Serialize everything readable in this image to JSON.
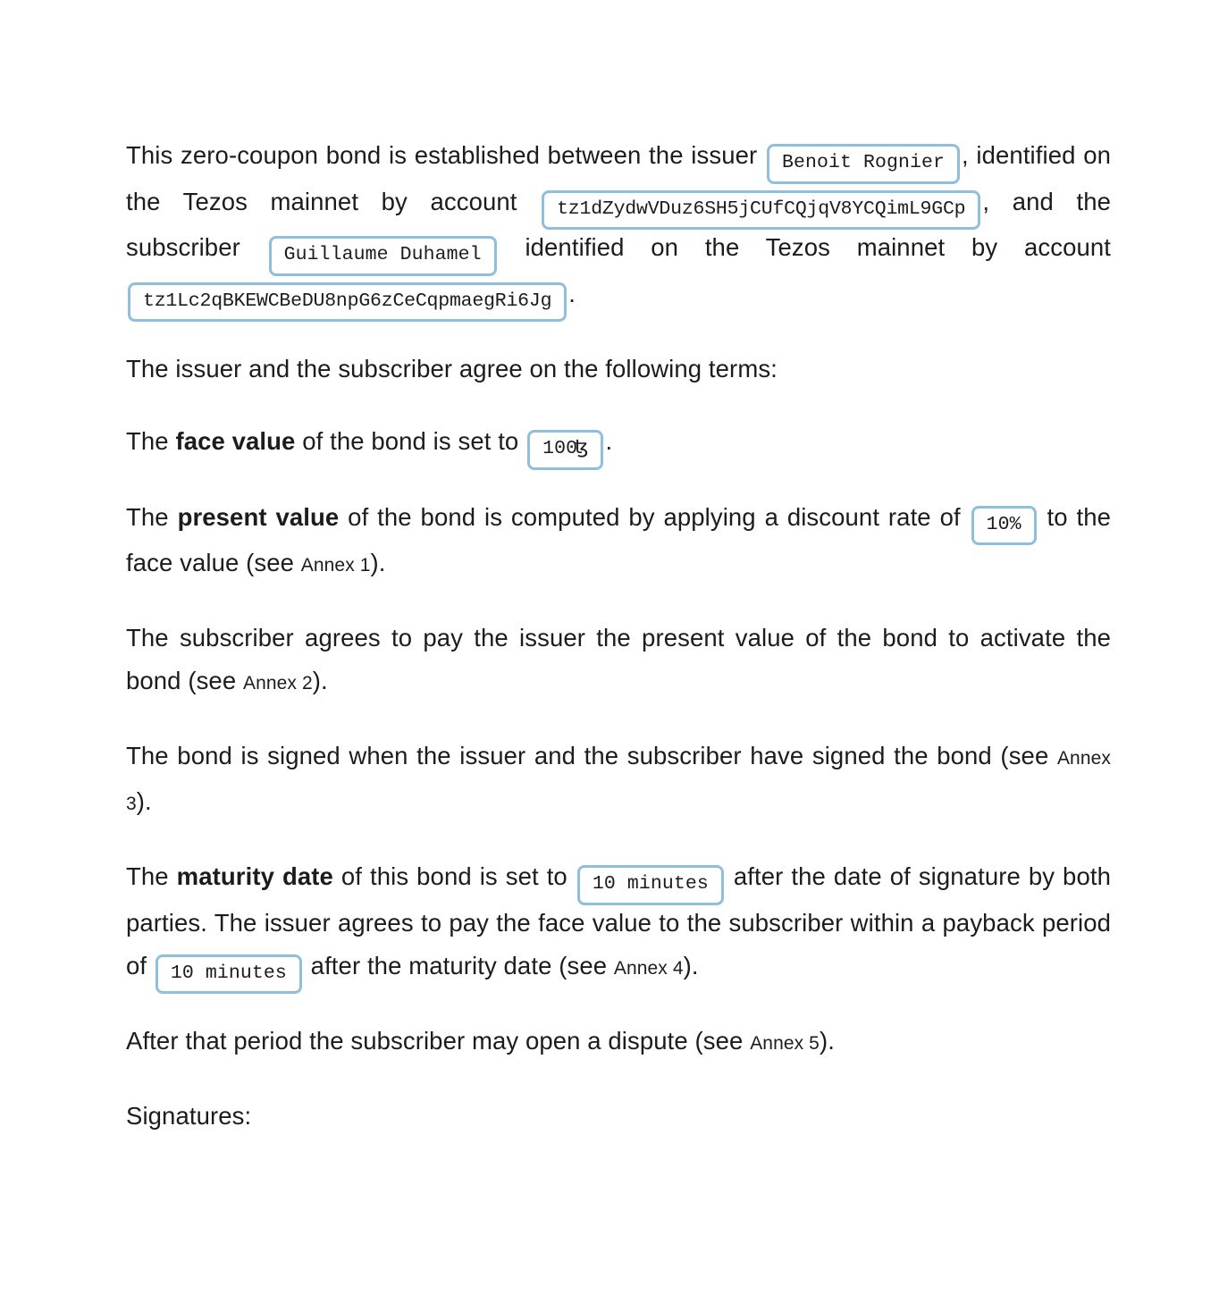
{
  "document": {
    "type": "zero-coupon-bond-contract",
    "accent_border_color": "#8fbfdd",
    "text_color": "#1c1c1c",
    "background_color": "#ffffff"
  },
  "intro": {
    "t1": "This zero-coupon bond is established between the issuer",
    "issuer_name": "Benoit Rognier",
    "t2": ", identified on the Tezos mainnet by account",
    "issuer_account": "tz1dZydwVDuz6SH5jCUfCQjqV8YCQimL9GCp",
    "t3": ", and the subscriber",
    "subscriber_name": "Guillaume Duhamel",
    "t4": "identified on the Tezos mainnet by account",
    "subscriber_account": "tz1Lc2qBKEWCBeDU8npG6zCeCqpmaegRi6Jg",
    "t5": "."
  },
  "terms_intro": "The issuer and the subscriber agree on the following terms:",
  "face_value": {
    "t1": "The",
    "label": "face value",
    "t2": "of the bond is set to",
    "amount": "100",
    "currency_symbol": "ꜩ",
    "t3": "."
  },
  "present_value": {
    "t1": "The",
    "label": "present value",
    "t2": "of the bond is computed by applying a discount rate of",
    "discount_rate": "10%",
    "t3": "to the face value (see",
    "annex": "Annex 1",
    "t4": ")."
  },
  "activation": {
    "t1": "The subscriber agrees to pay the issuer the present value of the bond to activate the bond (see",
    "annex": "Annex 2",
    "t2": ")."
  },
  "signing": {
    "t1": "The bond is signed when the issuer and the subscriber have signed the bond (see",
    "annex": "Annex 3",
    "t2": ")."
  },
  "maturity": {
    "t1": "The",
    "label": "maturity date",
    "t2": "of this bond is set to",
    "maturity_period": "10 minutes",
    "t3": "after the date of signature by both parties. The issuer agrees to pay the face value to the subscriber within a payback period of",
    "payback_period": "10 minutes",
    "t4": "after the maturity date (see",
    "annex": "Annex 4",
    "t5": ")."
  },
  "dispute": {
    "t1": "After that period the subscriber may open a dispute (see",
    "annex": "Annex 5",
    "t2": ")."
  },
  "signatures": {
    "heading": "Signatures:"
  }
}
